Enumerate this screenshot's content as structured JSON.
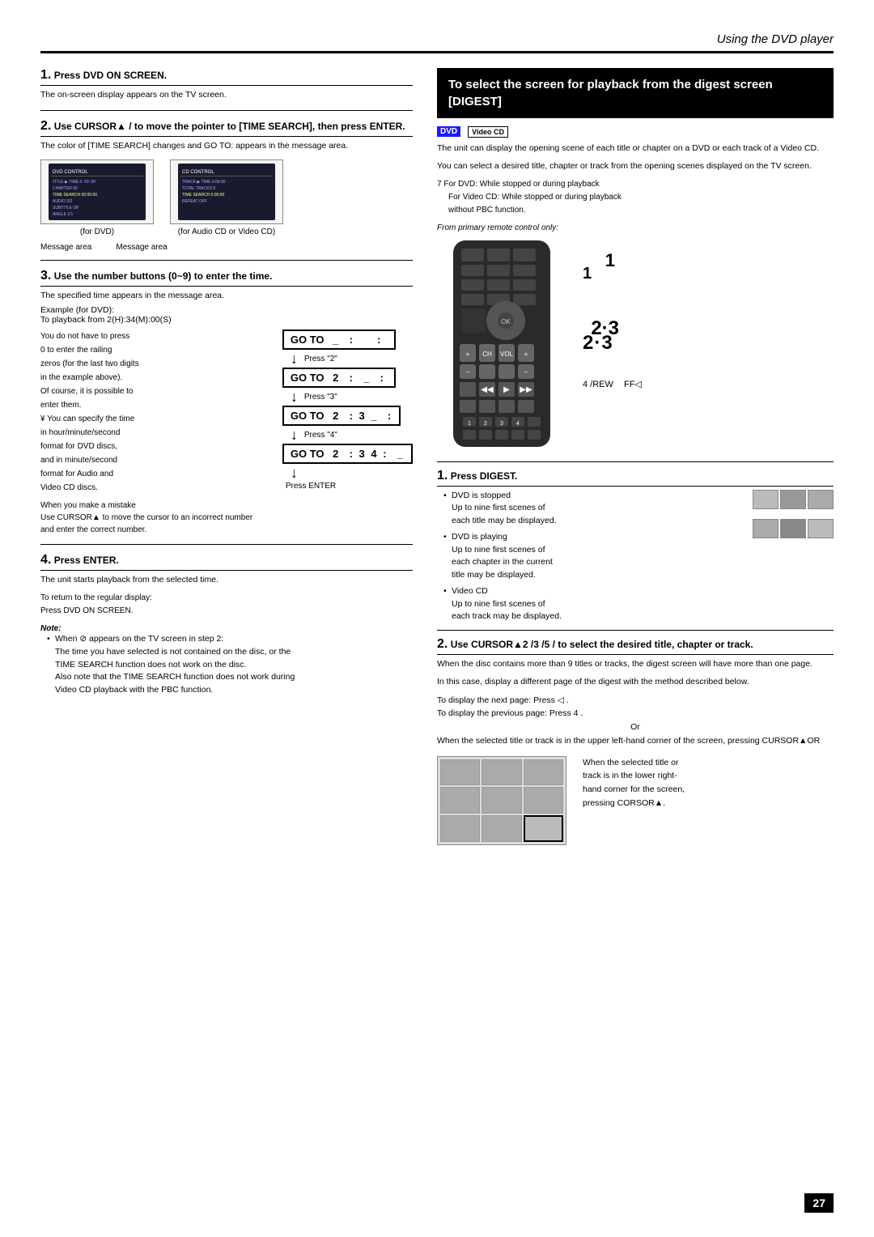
{
  "header": {
    "title": "Using the DVD player"
  },
  "page_number": "27",
  "left_column": {
    "step1": {
      "heading": "Press DVD ON SCREEN.",
      "sub": "The on-screen display appears on the TV screen."
    },
    "step2": {
      "heading": "Use CURSOR▲ /  to move the pointer to [TIME SEARCH], then press ENTER.",
      "sub1": "The color of [TIME SEARCH] changes and  GO TO: appears in the message area.",
      "image_label1": "(for DVD)",
      "image_label2": "(for Audio CD or Video CD)",
      "msg_area": "Message area",
      "msg_area2": "Message area"
    },
    "step3": {
      "heading": "Use the number buttons (0~9) to enter the time.",
      "sub": "The specified time appears in the message area.",
      "example_heading": "Example (for DVD):",
      "example_text": "To playback from 2(H):34(M):00(S)",
      "body_text1": "You do not have to press",
      "body_text2": "0  to enter the railing",
      "body_text3": "zeros (for the last two digits",
      "body_text4": "in the example above).",
      "body_text5": "Of course, it is possible to",
      "body_text6": "enter them.",
      "body_text7": "¥  You can specify the time",
      "body_text8": "in hour/minute/second",
      "body_text9": "format for DVD discs,",
      "body_text10": "and in minute/second",
      "body_text11": "format for Audio and",
      "body_text12": "Video CD discs.",
      "goto1": {
        "label": "GO TO",
        "value": "_ :    :"
      },
      "press1": "Press \"2\"",
      "goto2": {
        "label": "GO TO",
        "value": "2 :  _ :"
      },
      "press2": "Press \"3\"",
      "goto3": {
        "label": "GO TO",
        "value": "2 : 3 _ :"
      },
      "press3": "Press \"4\"",
      "goto4": {
        "label": "GO TO",
        "value": "2 : 3 4 :  _"
      },
      "press_enter": "Press ENTER",
      "mistake_text1": "When you make a mistake",
      "mistake_text2": "Use CURSOR▲ to move the cursor to an incorrect number",
      "mistake_text3": "and enter the correct number."
    },
    "step4": {
      "heading": "Press ENTER.",
      "sub": "The unit starts playback from the selected time.",
      "note1": "To return to the regular display:",
      "note2": "Press DVD ON SCREEN.",
      "note_heading": "Note:",
      "note_bullet1": "When ⊘ appears on the TV screen in step 2:",
      "note_bullet1a": "The time you have selected is not contained on the disc, or the",
      "note_bullet1b": "TIME SEARCH function does not work on the disc.",
      "note_bullet1c": "Also note that the TIME SEARCH function does not work during",
      "note_bullet1d": "Video CD playback with the PBC function."
    }
  },
  "right_column": {
    "header_text": "To select the screen for playback from the digest screen [DIGEST]",
    "dvd_badge": "DVD",
    "vcd_badge": "Video CD",
    "intro1": "The unit can display the opening scene of each title or chapter on a DVD or each track of a Video CD.",
    "intro2": "You can select a desired title, chapter or track from the opening scenes displayed on the TV screen.",
    "note_dvd": "7  For DVD: While stopped or during playback",
    "note_vcd": "For Video CD: While stopped or during playback",
    "note_vcd2": "without PBC function.",
    "remote_note": "From primary remote control only:",
    "annotation1": "1",
    "annotation23": "2·3",
    "annotation4_label": "4  /REW",
    "annotation4_ff": "FF◁",
    "step1": {
      "heading": "Press DIGEST.",
      "bullet1": "DVD is stopped",
      "bullet1a": "Up to nine first scenes of",
      "bullet1b": "each title may be displayed.",
      "bullet2": "DVD is playing",
      "bullet2a": "Up to nine first scenes of",
      "bullet2b": "each chapter in the current",
      "bullet2c": "title may be displayed.",
      "bullet3": "Video CD",
      "bullet3a": "Up to nine first scenes of",
      "bullet3b": "each track may be displayed."
    },
    "step2": {
      "heading": "Use CURSOR▲2 /3 /5 /  to select the desired title, chapter or track.",
      "body1": "When the disc contains more than 9 titles or tracks, the digest screen will have more than one page.",
      "body2": "In this case, display a different page of the digest with the method described below.",
      "next_page": "To display the next page: Press ◁  .",
      "prev_page": "To display the previous page:  Press 4   .",
      "or_text": "Or",
      "corner_text": "When the selected title or track is in the upper left-hand corner of the screen, pressing CURSOR▲OR",
      "bottom_note1": "When the selected title or",
      "bottom_note2": "track is in the lower right-",
      "bottom_note3": "hand corner for the screen,",
      "bottom_note4": "pressing CORSOR▲."
    }
  }
}
